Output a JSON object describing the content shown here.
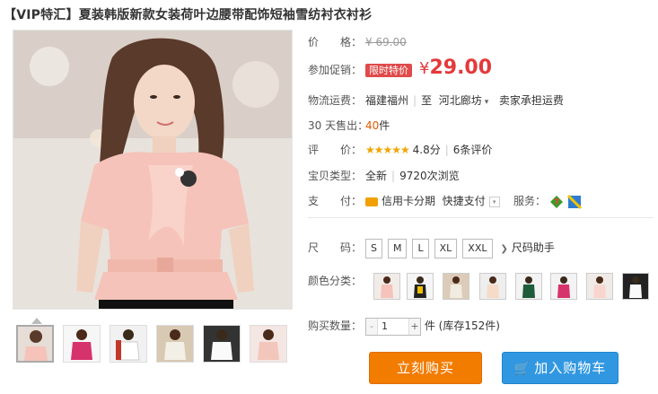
{
  "title": "【VIP特汇】夏装韩版新款女装荷叶边腰带配饰短袖雪纺衬衣衬衫",
  "price": {
    "label": "价　　格：",
    "original": "¥ 69.00"
  },
  "promo": {
    "label": "参加促销：",
    "tag": "限时特价",
    "yen": "¥",
    "value": "29.00"
  },
  "shipping": {
    "label": "物流运费：",
    "from": "福建福州",
    "sep": "|",
    "to_prefix": "至",
    "to": "河北廊坊",
    "fee": "卖家承担运费"
  },
  "sales": {
    "label": "30 天售出：",
    "count": "40",
    "unit": "件"
  },
  "rating": {
    "label": "评　　价：",
    "stars": "★★★★★",
    "score": "4.8分",
    "sep": "|",
    "reviews": "6条评价"
  },
  "item_type": {
    "label": "宝贝类型：",
    "condition": "全新",
    "sep": "|",
    "views": "9720次浏览"
  },
  "payment": {
    "label": "支　　付：",
    "method1": "信用卡分期",
    "method2": "快捷支付",
    "service_label": "服务："
  },
  "size": {
    "label": "尺　　码：",
    "options": [
      "S",
      "M",
      "L",
      "XL",
      "XXL"
    ],
    "helper": "尺码助手"
  },
  "color": {
    "label": "颜色分类："
  },
  "quantity": {
    "label": "购买数量：",
    "minus": "-",
    "value": "1",
    "plus": "+",
    "unit": "件",
    "stock": "(库存152件)"
  },
  "buttons": {
    "buy": "立刻购买",
    "cart": "加入购物车",
    "cart_icon": "cart-icon"
  },
  "colors": {
    "accent_red": "#e4393c",
    "buy_orange": "#f27c00",
    "cart_blue": "#3197e0"
  }
}
